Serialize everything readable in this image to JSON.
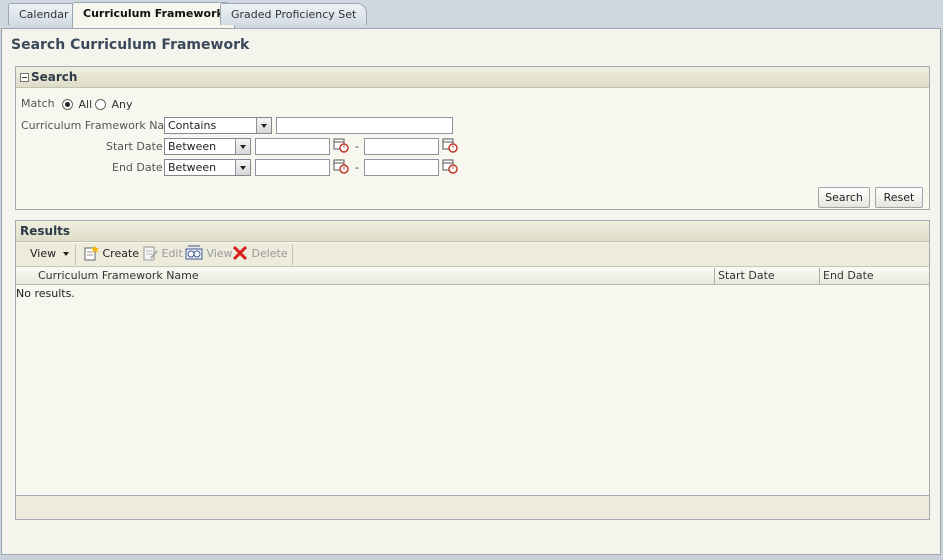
{
  "tabs": [
    {
      "label": "Calendar"
    },
    {
      "label": "Curriculum Framework"
    },
    {
      "label": "Graded Proficiency Set"
    }
  ],
  "page": {
    "title": "Search Curriculum Framework"
  },
  "search": {
    "header": "Search",
    "match_label": "Match",
    "match_all": "All",
    "match_any": "Any",
    "match_selected": "All",
    "name_label": "Curriculum Framework Name",
    "name_operator": "Contains",
    "name_value": "",
    "start_label": "Start Date",
    "start_operator": "Between",
    "end_label": "End Date",
    "end_operator": "Between",
    "range_separator": "-",
    "search_button": "Search",
    "reset_button": "Reset"
  },
  "results": {
    "header": "Results",
    "toolbar": {
      "view_menu": "View",
      "create": "Create",
      "edit": "Edit",
      "view": "View",
      "delete": "Delete"
    },
    "columns": [
      "Curriculum Framework Name",
      "Start Date",
      "End Date"
    ],
    "empty_text": "No results."
  },
  "icons": {
    "calendar": "calendar-icon",
    "create": "create-icon",
    "edit": "edit-icon",
    "view": "view-icon",
    "delete": "delete-icon"
  },
  "colors": {
    "accent": "#3a4a5a",
    "delete_red": "#d8201c"
  }
}
